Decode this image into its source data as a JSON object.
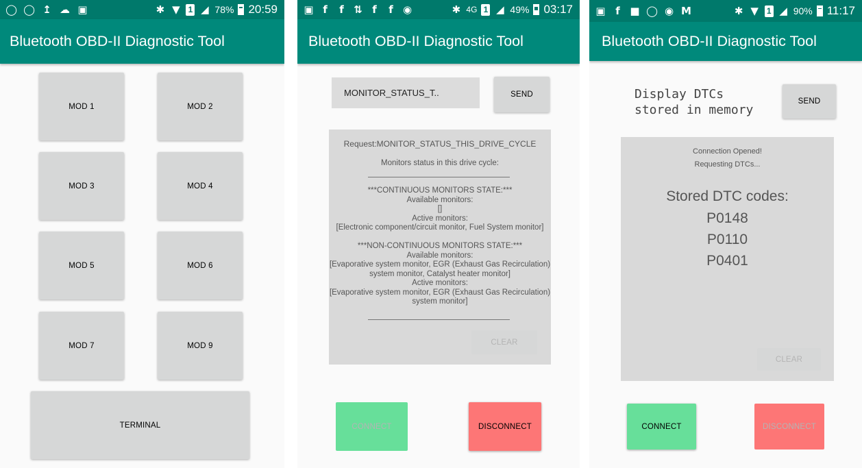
{
  "colors": {
    "status_bar": "#00796b",
    "app_bar": "#00897b",
    "button": "#d6d7d7",
    "panel": "#d9d9d9",
    "connect": "#67df9a",
    "disconnect": "#fd7676"
  },
  "screens": [
    {
      "status": {
        "left_icons": [
          "instagram-icon",
          "instagram-icon",
          "upload-icon",
          "cloud-icon",
          "image-icon"
        ],
        "battery": "78%",
        "time": "20:59"
      },
      "title": "Bluetooth OBD-II Diagnostic Tool",
      "mode_buttons": [
        "MOD 1",
        "MOD 2",
        "MOD 3",
        "MOD 4",
        "MOD 5",
        "MOD 6",
        "MOD 7",
        "MOD 9"
      ],
      "terminal_label": "TERMINAL"
    },
    {
      "status": {
        "left_icons": [
          "message-icon",
          "facebook-icon",
          "facebook-icon",
          "shuffle-icon",
          "facebook-icon",
          "facebook-icon",
          "messenger-icon"
        ],
        "network": "4G",
        "battery": "49%",
        "time": "03:17"
      },
      "title": "Bluetooth OBD-II Diagnostic Tool",
      "command_value": "MONITOR_STATUS_T..",
      "send_label": "SEND",
      "response": {
        "request_line": "Request:MONITOR_STATUS_THIS_DRIVE_CYCLE",
        "heading": "Monitors status in this drive cycle:",
        "lines": [
          "***CONTINUOUS MONITORS STATE:***",
          "Available monitors:",
          "[]",
          "Active monitors:",
          "[Electronic component/circuit monitor, Fuel System monitor]",
          "",
          "***NON-CONTINUOUS MONITORS STATE:***",
          "Available monitors:",
          "[Evaporative system monitor, EGR (Exhaust Gas Recirculation)",
          "system monitor, Catalyst heater monitor]",
          "Active monitors:",
          "[Evaporative system monitor, EGR (Exhaust Gas Recirculation)",
          "system monitor]"
        ]
      },
      "clear_label": "CLEAR",
      "connect_label": "CONNECT",
      "disconnect_label": "DISCONNECT"
    },
    {
      "status": {
        "left_icons": [
          "message-icon",
          "facebook-icon",
          "chat-icon",
          "instagram-icon",
          "messenger-icon",
          "gmail-icon"
        ],
        "battery": "90%",
        "time": "11:17"
      },
      "title": "Bluetooth OBD-II Diagnostic Tool",
      "command_line1": "Display DTCs",
      "command_line2": "stored in memory",
      "send_label": "SEND",
      "response": {
        "line1": "Connection Opened!",
        "line2": "Requesting DTCs...",
        "codes_heading": "Stored DTC codes:",
        "codes": [
          "P0148",
          "P0110",
          "P0401"
        ]
      },
      "clear_label": "CLEAR",
      "connect_label": "CONNECT",
      "disconnect_label": "DISCONNECT"
    }
  ]
}
